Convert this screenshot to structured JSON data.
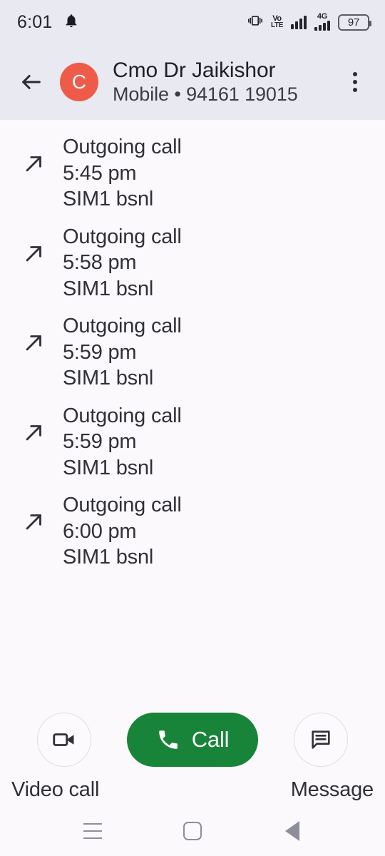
{
  "status_bar": {
    "time": "6:01",
    "notification_icon": "bell-icon",
    "vibrate_icon": "vibrate-icon",
    "volte_top": "Vo",
    "volte_bottom": "LTE",
    "network_label": "4G",
    "battery_level": "97"
  },
  "header": {
    "back_icon": "back-arrow-icon",
    "avatar_initial": "C",
    "avatar_color": "#EE5B48",
    "contact_name": "Cmo Dr Jaikishor",
    "contact_subtitle": "Mobile • 94161 19015",
    "overflow_icon": "more-vertical-icon",
    "background_color": "#E9E9F1"
  },
  "call_history": [
    {
      "direction_icon": "outgoing-call-arrow-icon",
      "type": "Outgoing call",
      "time": "5:45 pm",
      "sim": "SIM1 bsnl"
    },
    {
      "direction_icon": "outgoing-call-arrow-icon",
      "type": "Outgoing call",
      "time": "5:58 pm",
      "sim": "SIM1 bsnl"
    },
    {
      "direction_icon": "outgoing-call-arrow-icon",
      "type": "Outgoing call",
      "time": "5:59 pm",
      "sim": "SIM1 bsnl"
    },
    {
      "direction_icon": "outgoing-call-arrow-icon",
      "type": "Outgoing call",
      "time": "5:59 pm",
      "sim": "SIM1 bsnl"
    },
    {
      "direction_icon": "outgoing-call-arrow-icon",
      "type": "Outgoing call",
      "time": "6:00 pm",
      "sim": "SIM1 bsnl"
    }
  ],
  "actions": {
    "video_call_icon": "video-camera-icon",
    "video_call_label": "Video call",
    "call_icon": "phone-icon",
    "call_label": "Call",
    "call_button_color": "#18843A",
    "message_icon": "message-bubble-icon",
    "message_label": "Message"
  },
  "nav_bar": {
    "recents_icon": "recents-icon",
    "home_icon": "home-square-icon",
    "back_icon": "back-triangle-icon"
  }
}
